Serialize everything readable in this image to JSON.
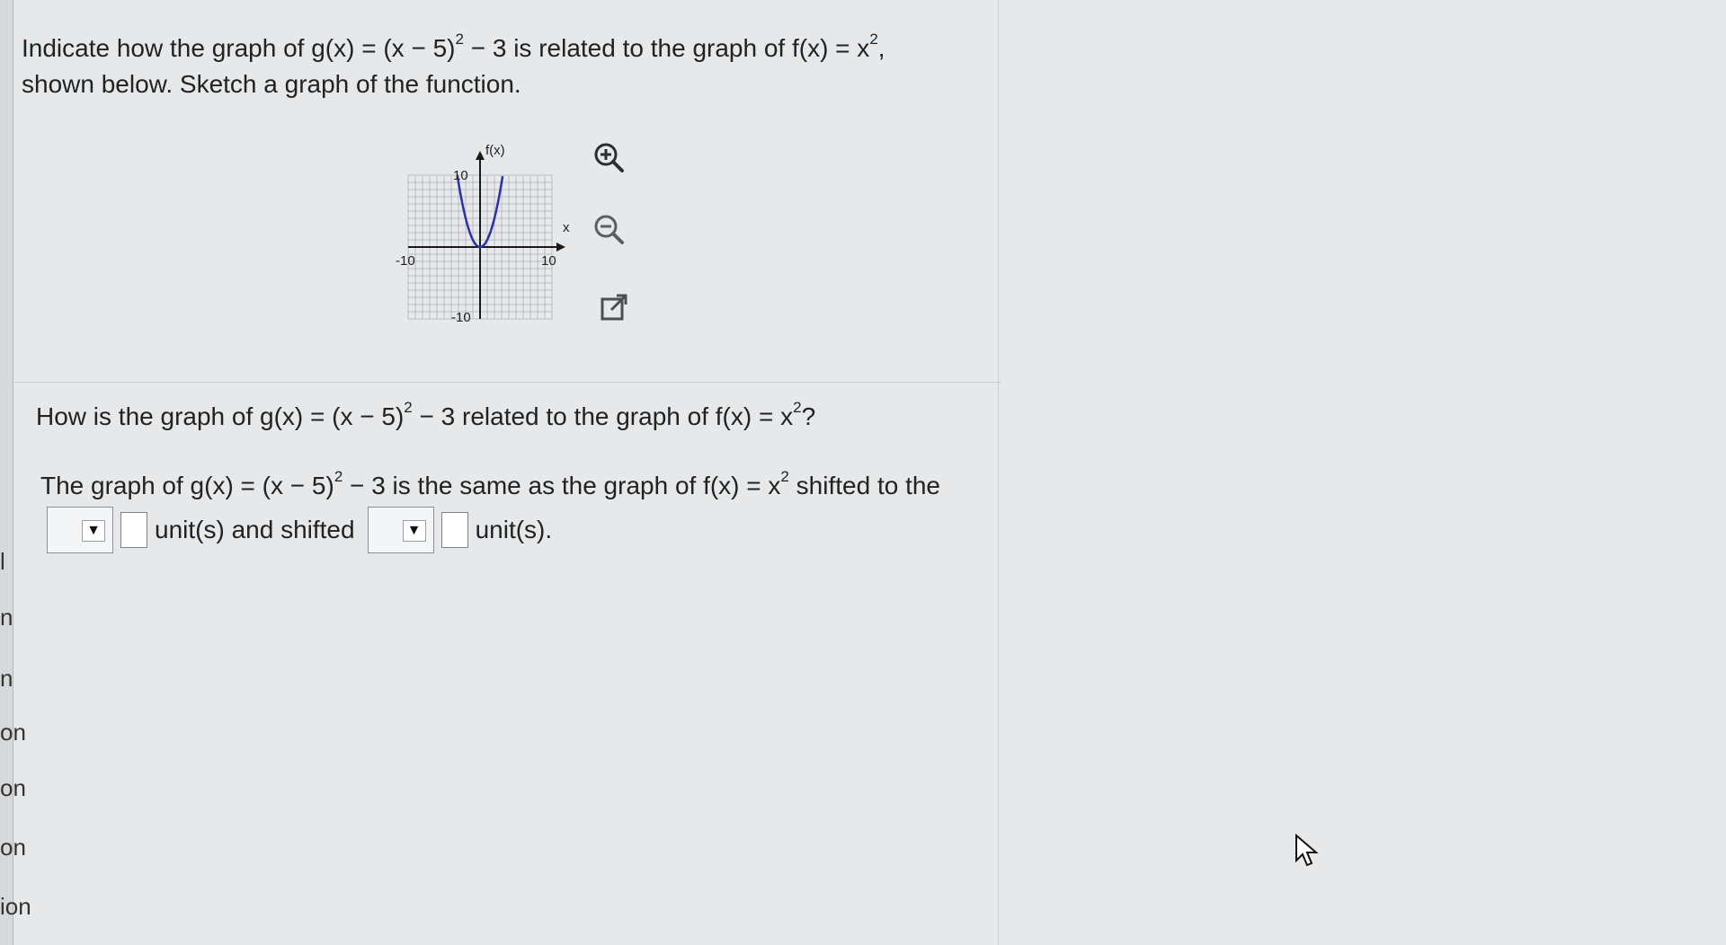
{
  "prompt": {
    "line1_a": "Indicate how the graph of g(x) = (x − 5)",
    "line1_exp": "2",
    "line1_b": " − 3 is related to the graph of f(x) = x",
    "line1_exp2": "2",
    "line1_c": ",",
    "line2": "shown below. Sketch a graph of the function."
  },
  "graph": {
    "y_axis_label": "f(x)",
    "x_axis_label": "x",
    "tick_top": "10",
    "tick_bottom": "-10",
    "tick_left": "-10",
    "tick_right": "10"
  },
  "tools": {
    "zoom_in": "zoom-in",
    "zoom_out": "zoom-out",
    "popout": "open-in-new-window"
  },
  "question": {
    "a": "How is the graph of g(x) = (x − 5)",
    "exp": "2",
    "b": " − 3 related to the graph of f(x) = x",
    "exp2": "2",
    "c": "?"
  },
  "answer": {
    "a": "The graph of g(x) = (x − 5)",
    "exp": "2",
    "b": " − 3 is the same as the graph of f(x) = x",
    "exp2": "2",
    "c": " shifted to the",
    "unit1": "unit(s) and shifted",
    "unit2": "unit(s)."
  },
  "left_rail": [
    "l",
    "n",
    "n",
    "on",
    "on",
    "on",
    "ion"
  ],
  "colors": {
    "curve": "#2b2fa8",
    "grid": "#b9bcbf",
    "accent": "#1a1a1a"
  }
}
